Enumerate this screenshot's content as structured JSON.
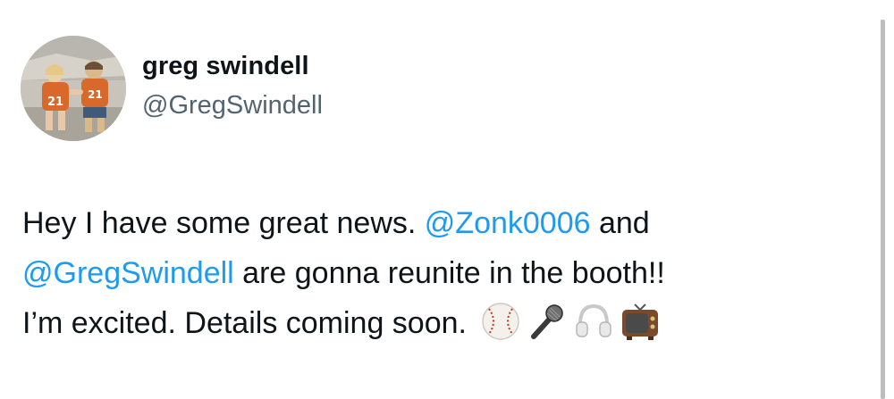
{
  "author": {
    "display_name": "greg swindell",
    "handle": "@GregSwindell",
    "avatar": "avatar-photo-two-kids-orange-jerseys",
    "avatar_jersey_number": "21"
  },
  "tweet": {
    "line1": {
      "text_before": "Hey I have some great news. ",
      "mention": "@Zonk0006",
      "text_after": " and"
    },
    "line2": {
      "mention": "@GregSwindell",
      "text_after": " are gonna reunite in the booth!!"
    },
    "line3": {
      "text": "I’m excited. Details coming soon."
    },
    "emojis": [
      "baseball-icon",
      "microphone-icon",
      "headphones-icon",
      "television-icon"
    ]
  },
  "colors": {
    "mention": "#1d9bf0",
    "handle": "#536471",
    "text": "#0f1419",
    "jersey": "#d9692a"
  }
}
